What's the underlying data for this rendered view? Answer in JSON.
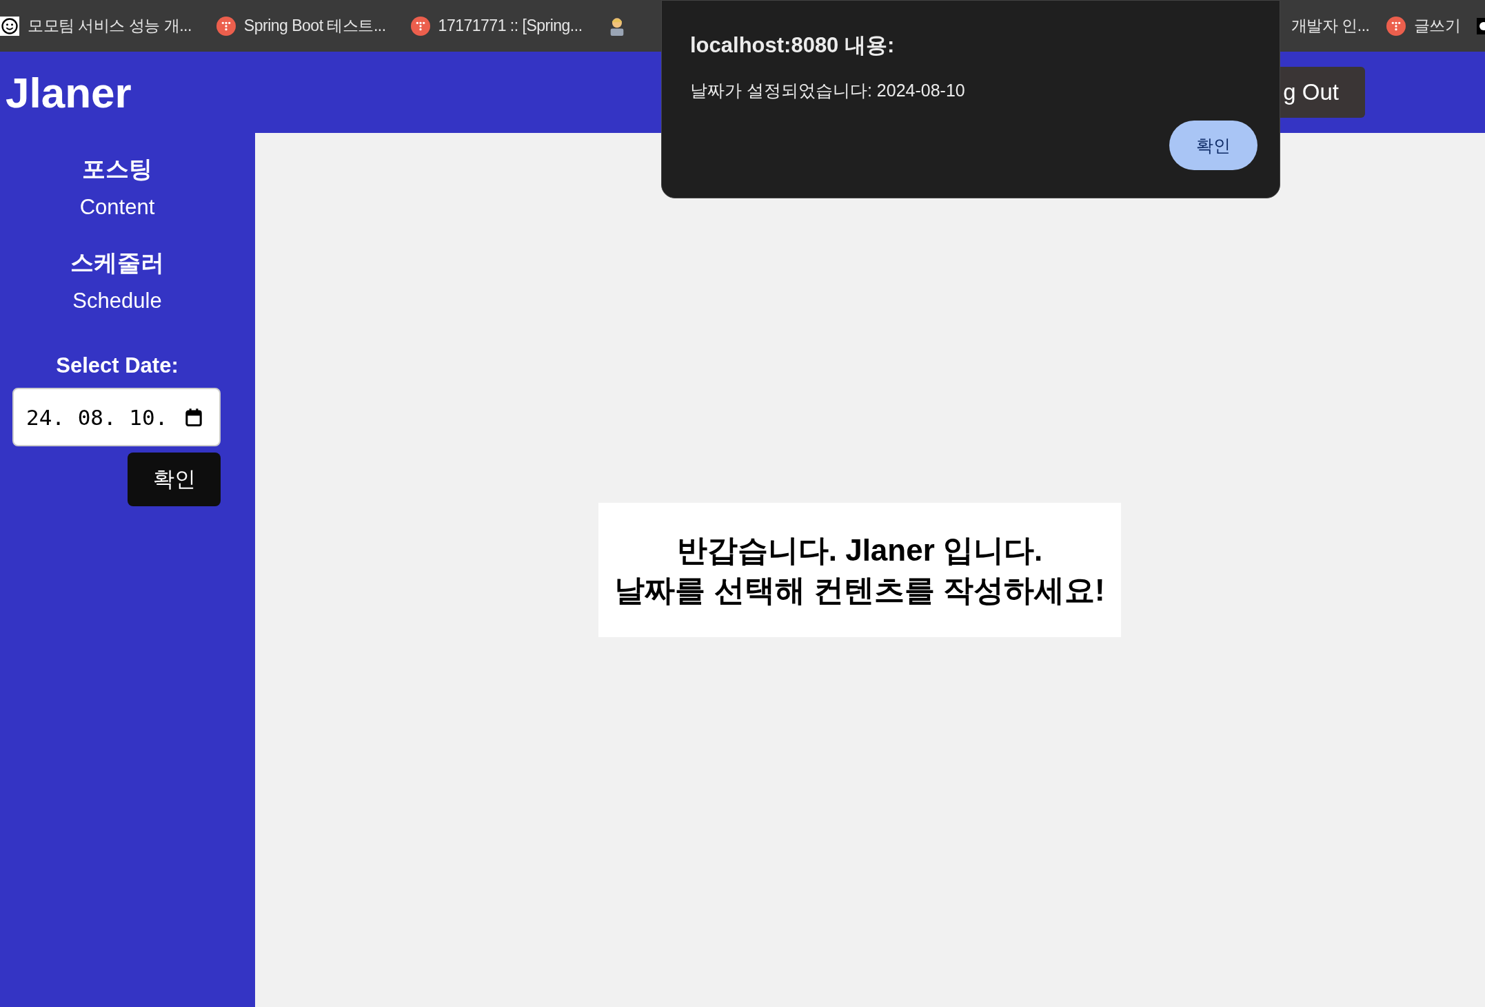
{
  "bookmarks": {
    "left": [
      {
        "kind": "smiley",
        "label": "모모팀 서비스 성능 개..."
      },
      {
        "kind": "t-badge",
        "label": "Spring Boot 테스트..."
      },
      {
        "kind": "t-badge",
        "label": "17171771 :: [Spring..."
      },
      {
        "kind": "person"
      }
    ],
    "right": [
      {
        "kind": "plain",
        "label": "개발자 인..."
      },
      {
        "kind": "t-badge",
        "label": "글쓰기"
      },
      {
        "kind": "dark"
      }
    ]
  },
  "header": {
    "logo": "Jlaner",
    "logout_button": "g Out"
  },
  "sidebar": {
    "sections": [
      {
        "title": "포스팅",
        "link": "Content"
      },
      {
        "title": "스케줄러",
        "link": "Schedule"
      }
    ],
    "date_label": "Select Date:",
    "date_value": "24. 08. 10.",
    "confirm_button": "확인"
  },
  "welcome": {
    "lines": [
      "반갑습니다. Jlaner 입니다.",
      "날짜를 선택해 컨텐츠를 작성하세요!"
    ]
  },
  "dialog": {
    "title": "localhost:8080 내용:",
    "message": "날짜가 설정되었습니다: 2024-08-10",
    "ok_button": "확인"
  }
}
